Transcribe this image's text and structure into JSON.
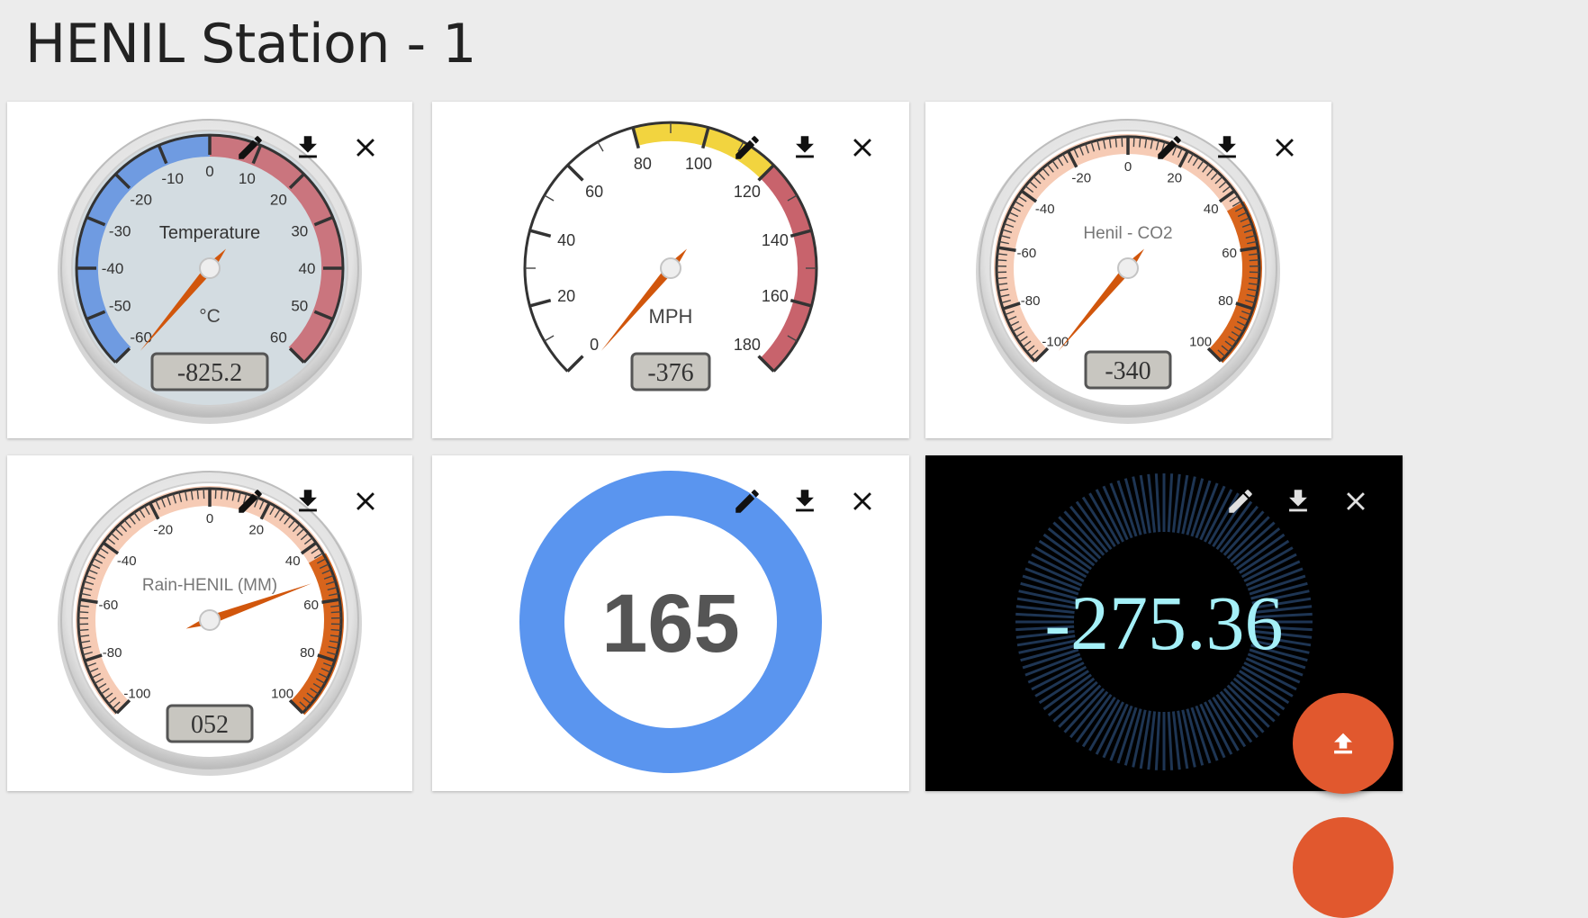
{
  "page": {
    "title": "HENIL Station - 1"
  },
  "icons": {
    "edit": "pencil-icon",
    "download": "download-icon",
    "close": "close-icon",
    "fab": "upload-icon"
  },
  "colors": {
    "needle": "#d1560c",
    "blue_zone": "#5d8fe0",
    "red_zone": "#c8636c",
    "yellow_zone": "#f2d43f",
    "orange_zone": "#d8641c",
    "donut": "#5a95ef",
    "digital_text": "#a5f0f8",
    "fab": "#e1582e"
  },
  "widgets": [
    {
      "id": "temperature",
      "type": "gauge",
      "label": "Temperature",
      "unit": "°C",
      "display": "-825.2",
      "value": -825.2,
      "min": -60,
      "max": 60,
      "ticks": [
        "-60",
        "-50",
        "-40",
        "-30",
        "-20",
        "-10",
        "0",
        "10",
        "20",
        "30",
        "40",
        "50",
        "60"
      ]
    },
    {
      "id": "speed",
      "type": "gauge",
      "label": "",
      "unit": "MPH",
      "display": "-376",
      "value": -376,
      "min": 0,
      "max": 180,
      "ticks": [
        "0",
        "20",
        "40",
        "60",
        "80",
        "100",
        "120",
        "140",
        "160",
        "180"
      ]
    },
    {
      "id": "co2",
      "type": "gauge",
      "label": "Henil - CO2",
      "unit": "",
      "display": "-340",
      "value": -340,
      "min": -100,
      "max": 100,
      "ticks": [
        "-100",
        "-80",
        "-60",
        "-40",
        "-20",
        "0",
        "20",
        "40",
        "60",
        "80",
        "100"
      ]
    },
    {
      "id": "rain",
      "type": "gauge",
      "label": "Rain-HENIL (MM)",
      "unit": "",
      "display": "052",
      "value": 52,
      "min": -100,
      "max": 100,
      "ticks": [
        "-100",
        "-80",
        "-60",
        "-40",
        "-20",
        "0",
        "20",
        "40",
        "60",
        "80",
        "100"
      ]
    },
    {
      "id": "donut",
      "type": "donut",
      "display": "165",
      "value": 165
    },
    {
      "id": "digital",
      "type": "digital",
      "display": "-275.36",
      "value": -275.36
    }
  ]
}
